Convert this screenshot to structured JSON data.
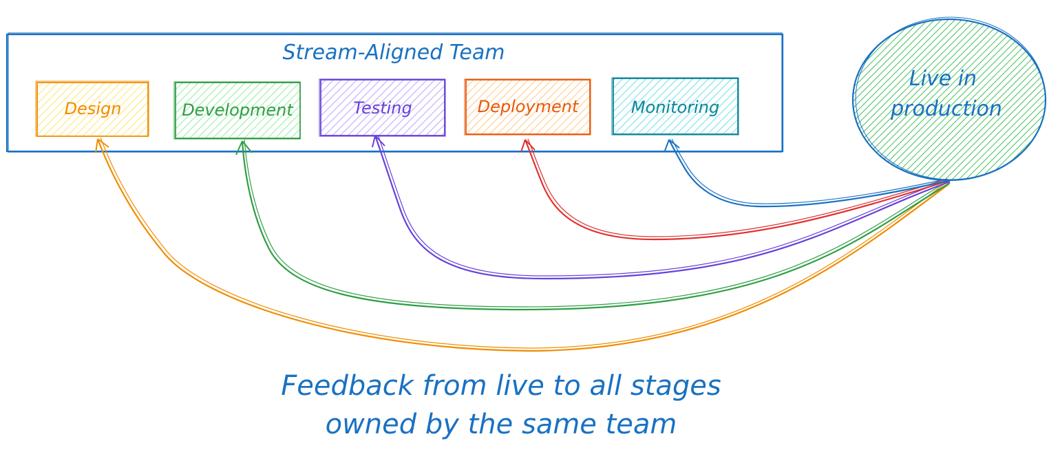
{
  "team": {
    "title": "Stream-Aligned Team",
    "color": "#1971c2"
  },
  "stages": [
    {
      "id": "design",
      "label": "Design",
      "color": "#f08c00",
      "fill": "#ffec99"
    },
    {
      "id": "development",
      "label": "Development",
      "color": "#2f9e44",
      "fill": "#b2f2bb"
    },
    {
      "id": "testing",
      "label": "Testing",
      "color": "#6741d9",
      "fill": "#d0bfff"
    },
    {
      "id": "deployment",
      "label": "Deployment",
      "color": "#e8590c",
      "fill": "#ffd8a8"
    },
    {
      "id": "monitoring",
      "label": "Monitoring",
      "color": "#0c8599",
      "fill": "#99e9f2"
    }
  ],
  "live": {
    "line1": "Live in",
    "line2": "production",
    "color": "#1971c2",
    "fill": "#40c057"
  },
  "arrows": [
    {
      "to": "design",
      "color": "#f08c00"
    },
    {
      "to": "development",
      "color": "#2f9e44"
    },
    {
      "to": "testing",
      "color": "#6741d9"
    },
    {
      "to": "deployment",
      "color": "#e03131"
    },
    {
      "to": "monitoring",
      "color": "#1971c2"
    }
  ],
  "caption": {
    "line1": "Feedback from live to all stages",
    "line2": "owned by the same team",
    "color": "#1971c2"
  }
}
